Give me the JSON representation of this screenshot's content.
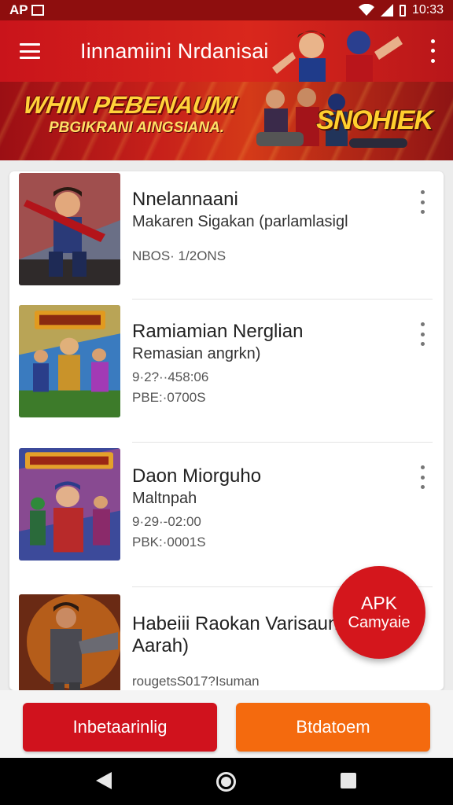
{
  "status_bar": {
    "left_text": "AP",
    "time": "10:33"
  },
  "app_bar": {
    "title": "Iinnamiini Nrdanisai"
  },
  "banner": {
    "headline": "WHIN PEBENAUM!",
    "subline": "PBGIKRANI AINGSIANA.",
    "logo": "SNOHIEK"
  },
  "list": {
    "items": [
      {
        "title": "Nnelannaani",
        "subtitle": "Makaren Sigakan (parlamlasigl",
        "line3": "",
        "line4": "NBOS· 1/2ONS"
      },
      {
        "title": "Ramiamian Nerglian",
        "subtitle": "Remasian angrkn)",
        "line3": "9·2?··458:06",
        "line4": "PBE:·0700S"
      },
      {
        "title": "Daon Miorguho",
        "subtitle": "Maltnpah",
        "line3": "9·29·-02:00",
        "line4": "PBK:·0001S"
      },
      {
        "title": "Habeiii Raokan Varisaun",
        "subtitle": "Aarah)",
        "line3": "",
        "line4": "rougetsS017?Isuman"
      }
    ]
  },
  "fab": {
    "line1": "APK",
    "line2": "Camyaie"
  },
  "actions": {
    "primary_label": "Inbetaarinlig",
    "secondary_label": "Btdatoem"
  },
  "colors": {
    "brand_red": "#d4161c",
    "accent_orange": "#f46a0e",
    "status_bar": "#8e0e0e"
  },
  "icons": {
    "menu": "hamburger-icon",
    "overflow": "more-vert-icon",
    "wifi": "wifi-icon",
    "signal": "signal-icon",
    "battery": "battery-icon"
  }
}
